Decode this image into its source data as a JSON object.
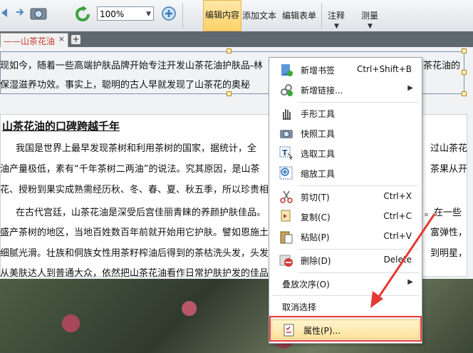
{
  "toolbar": {
    "zoom_value": "100%",
    "buttons": [
      {
        "label": "编辑内容",
        "active": true
      },
      {
        "label": "添加文本",
        "active": false
      },
      {
        "label": "编辑表单",
        "active": false
      },
      {
        "label": "注释",
        "active": false
      },
      {
        "label": "测量",
        "active": false
      }
    ]
  },
  "tabs": [
    {
      "label": "——山茶花油"
    }
  ],
  "document": {
    "intro_lines": [
      "现如今，随着一些高端护肤品牌开始专注开发山茶花油护肤品-林",
      "保湿滋养功效。事实上，聪明的古人早就发现了山茶花的奥秘"
    ],
    "intro_right": "茶花油的",
    "heading": "山茶花油的口碑跨越千年",
    "para_lines": [
      "我国是世界上最早发现茶树和利用茶树的国家，据统计，全",
      "油产量极低，素有“千年茶树二两油”的说法。究其原因，是山茶",
      "花、授粉到果实成熟需经历秋、冬、春、夏、秋五季，所以珍贵相",
      "在古代宫廷，山茶花油是深受后宫佳丽青睐的养颜护肤佳品。",
      "盛产茶树的地区，当地百姓数百年前就开始用它护肤。譬如恩施土",
      "细腻光滑。壮族和侗族女性用茶籽榨油后得到的茶枯洗头发，头发",
      "从美肤达人到普通大众，依然把山茶花油看作日常护肤护发的佳品"
    ],
    "right_fragments": [
      "过山茶花",
      "茶果从开",
      "。在一些",
      "富弹性，",
      "到明星，"
    ]
  },
  "context_menu": {
    "items": [
      {
        "label": "新增书签",
        "shortcut": "Ctrl+Shift+B",
        "icon": "bookmark-add-icon"
      },
      {
        "label": "新增链接...",
        "shortcut": "",
        "submenu": true,
        "icon": "link-add-icon"
      },
      {
        "label": "手形工具",
        "shortcut": "",
        "icon": "hand-tool-icon"
      },
      {
        "label": "快照工具",
        "shortcut": "",
        "icon": "camera-icon"
      },
      {
        "label": "选取工具",
        "shortcut": "",
        "icon": "select-text-icon"
      },
      {
        "label": "缩放工具",
        "shortcut": "",
        "icon": "zoom-tool-icon"
      },
      {
        "label": "剪切(T)",
        "shortcut": "Ctrl+X",
        "icon": "scissors-icon"
      },
      {
        "label": "复制(C)",
        "shortcut": "Ctrl+C",
        "icon": "copy-icon"
      },
      {
        "label": "粘贴(P)",
        "shortcut": "Ctrl+V",
        "icon": "paste-icon"
      },
      {
        "label": "删除(D)",
        "shortcut": "Delete",
        "icon": "delete-icon"
      },
      {
        "label": "叠放次序(O)",
        "shortcut": "",
        "submenu": true,
        "icon": ""
      },
      {
        "label": "取消选择",
        "shortcut": "",
        "icon": ""
      },
      {
        "label": "属性(P)...",
        "shortcut": "",
        "icon": "properties-icon",
        "highlighted": true
      }
    ]
  },
  "colors": {
    "highlight_box": "#e53935",
    "arrow": "#e53935",
    "tab_text": "#c0392b"
  }
}
